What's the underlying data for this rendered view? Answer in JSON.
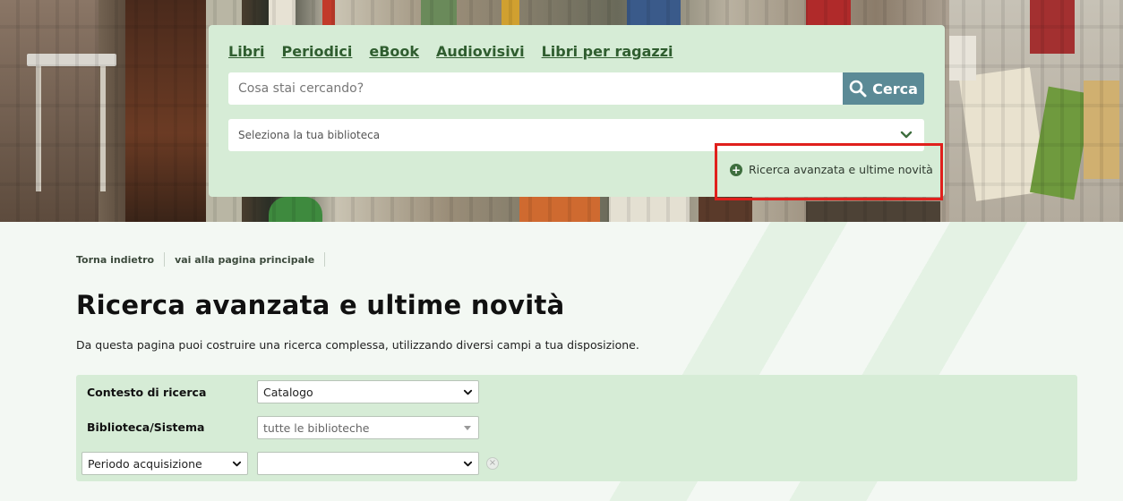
{
  "search": {
    "tabs": [
      "Libri",
      "Periodici",
      "eBook",
      "Audiovisivi",
      "Libri per ragazzi"
    ],
    "placeholder": "Cosa stai cercando?",
    "button_label": "Cerca",
    "library_select": "Seleziona la tua biblioteca",
    "advanced_link": "Ricerca avanzata e ultime novità"
  },
  "breadcrumb": {
    "back": "Torna indietro",
    "home": "vai alla pagina principale"
  },
  "page": {
    "title": "Ricerca avanzata e ultime novità",
    "description": "Da questa pagina puoi costruire una ricerca complessa, utilizzando diversi campi a tua disposizione."
  },
  "form": {
    "context_label": "Contesto di ricerca",
    "context_value": "Catalogo",
    "library_label": "Biblioteca/Sistema",
    "library_value": "tutte le biblioteche",
    "field_select": "Periodo acquisizione",
    "field_value": ""
  },
  "colors": {
    "panel": "#d6ecd6",
    "search_button": "#5b8a96",
    "highlight": "#e0201c",
    "link": "#2f5d2f"
  }
}
